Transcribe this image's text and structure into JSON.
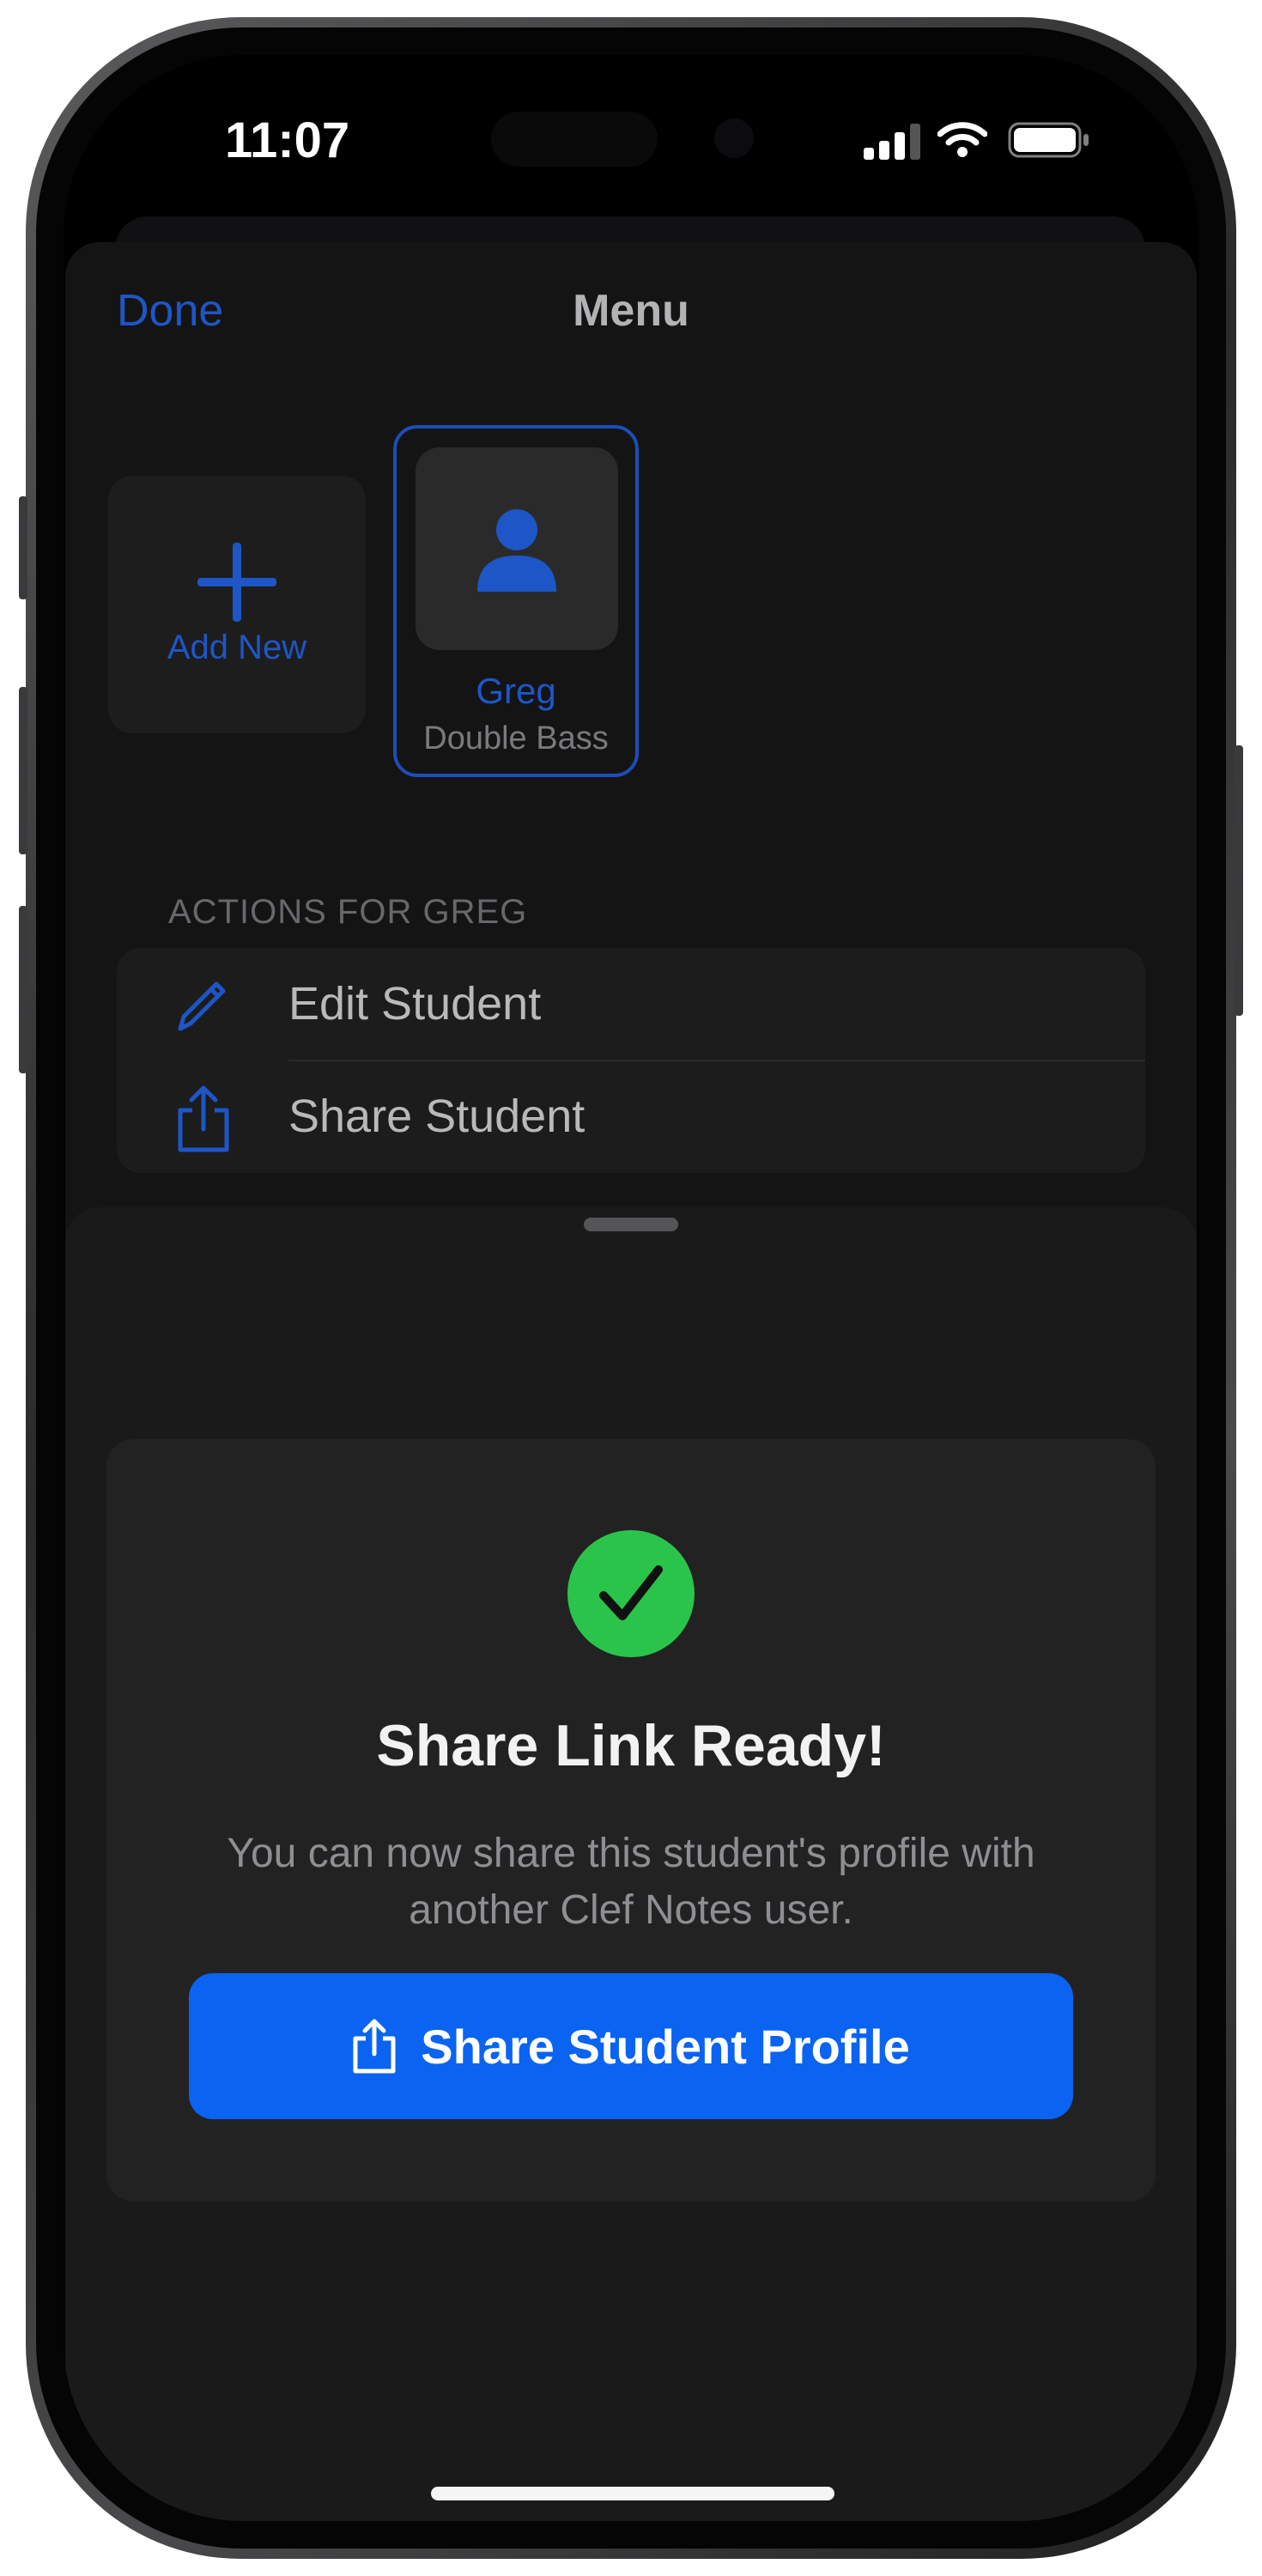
{
  "status_bar": {
    "time": "11:07",
    "icons": [
      "cellular-signal-icon",
      "wifi-icon",
      "battery-icon"
    ]
  },
  "menu": {
    "nav": {
      "done_label": "Done",
      "title": "Menu"
    },
    "students": {
      "add_new_label": "Add New",
      "items": [
        {
          "name": "Greg",
          "instrument": "Double Bass",
          "selected": true
        }
      ]
    },
    "actions": {
      "header": "ACTIONS FOR GREG",
      "items": [
        {
          "label": "Edit Student",
          "icon": "pencil-icon"
        },
        {
          "label": "Share Student",
          "icon": "share-icon"
        }
      ]
    }
  },
  "share_sheet": {
    "icon": "checkmark-circle-icon",
    "title": "Share Link Ready!",
    "description_line1": "You can now share this student's profile with",
    "description_line2": "another Clef Notes user.",
    "button_label": "Share Student Profile",
    "button_icon": "share-icon"
  },
  "colors": {
    "accent": "#1e56c7",
    "primary_button": "#0b63f1",
    "success": "#2bc44a",
    "background": "#141415"
  }
}
